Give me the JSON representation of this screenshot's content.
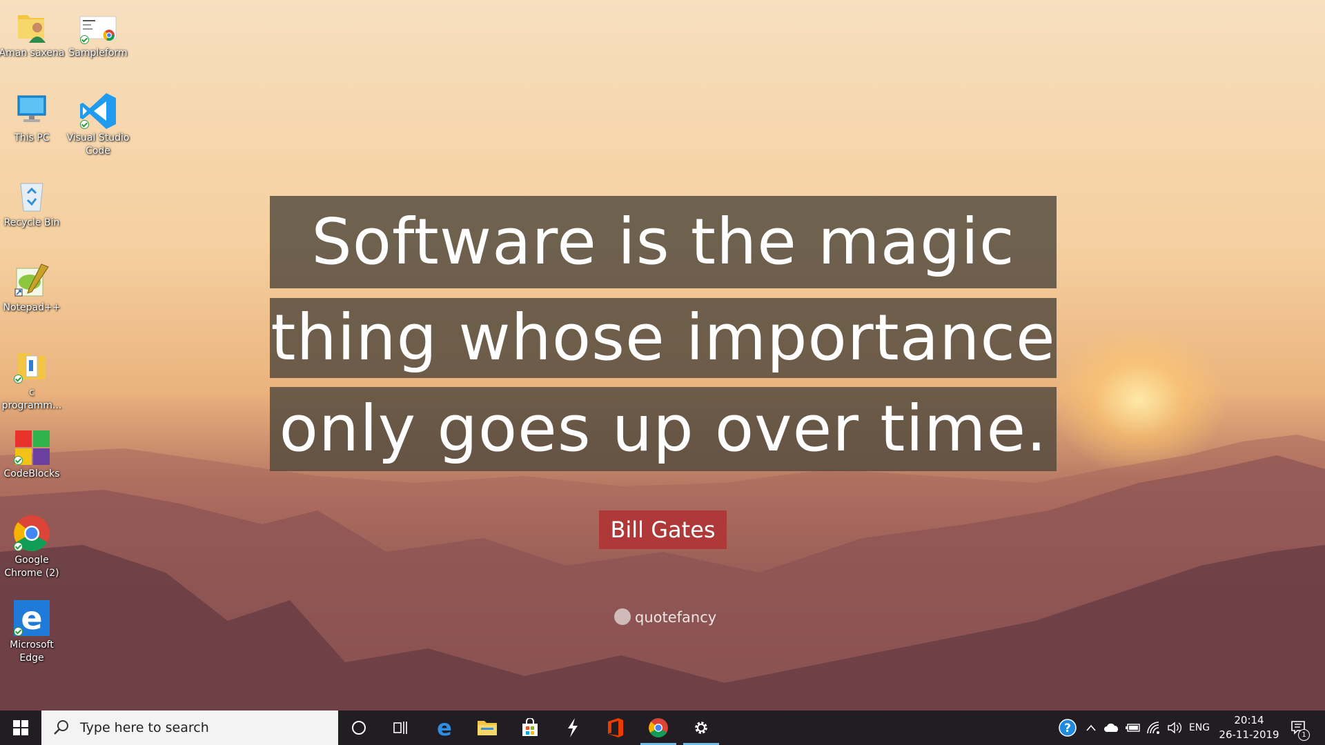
{
  "desktop": {
    "icons": [
      {
        "label": "Aman saxena"
      },
      {
        "label": "Sampleform"
      },
      {
        "label": "This PC"
      },
      {
        "label": "Visual Studio Code"
      },
      {
        "label": "Recycle Bin"
      },
      {
        "label": "Notepad++"
      },
      {
        "label": "c programm..."
      },
      {
        "label": "CodeBlocks"
      },
      {
        "label": "Google Chrome (2)"
      },
      {
        "label": "Microsoft Edge"
      }
    ]
  },
  "wallpaper": {
    "quote_lines": [
      "Software is the magic",
      "thing whose importance",
      "only goes up over time."
    ],
    "author": "Bill Gates",
    "watermark": "quotefancy"
  },
  "taskbar": {
    "search_placeholder": "Type here to search",
    "pinned": [
      "cortana-icon",
      "task-view-icon",
      "edge-icon",
      "file-explorer-icon",
      "store-icon",
      "winscp-icon",
      "office-icon",
      "chrome-icon",
      "settings-icon"
    ],
    "tray": {
      "language": "ENG",
      "time": "20:14",
      "date": "26-11-2019",
      "notification_count": "1"
    }
  },
  "colors": {
    "taskbar": "#211d22",
    "quote_box": "#50483c",
    "author_box": "#af3434",
    "active_indicator": "#76b9ed"
  }
}
